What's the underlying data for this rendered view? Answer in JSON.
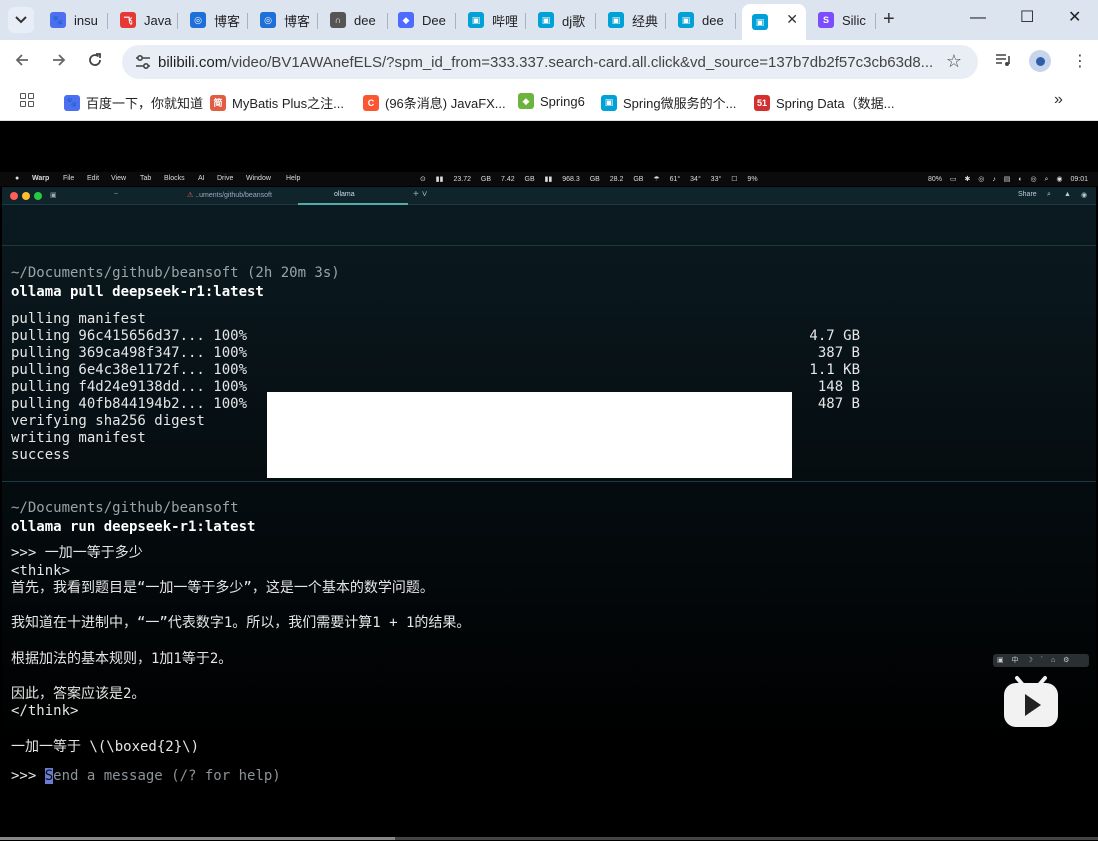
{
  "browser": {
    "tabs": [
      {
        "label": "insu",
        "favicon_color": "#4e6ef2",
        "favicon_glyph": "🐾"
      },
      {
        "label": "Java",
        "favicon_color": "#e53935",
        "favicon_glyph": "飞"
      },
      {
        "label": "博客",
        "favicon_color": "#1e6fd9",
        "favicon_glyph": "◎"
      },
      {
        "label": "博客",
        "favicon_color": "#1e6fd9",
        "favicon_glyph": "◎"
      },
      {
        "label": "dee",
        "favicon_color": "#555555",
        "favicon_glyph": "∩"
      },
      {
        "label": "Dee",
        "favicon_color": "#4d6bfe",
        "favicon_glyph": "◆"
      },
      {
        "label": "哔哩",
        "favicon_color": "#00a1d6",
        "favicon_glyph": "▣"
      },
      {
        "label": "dj歌",
        "favicon_color": "#00a1d6",
        "favicon_glyph": "▣"
      },
      {
        "label": "经典",
        "favicon_color": "#00a1d6",
        "favicon_glyph": "▣"
      },
      {
        "label": "dee",
        "favicon_color": "#00a1d6",
        "favicon_glyph": "▣"
      },
      {
        "label": "",
        "favicon_color": "#00a1d6",
        "favicon_glyph": "▣",
        "active": true
      },
      {
        "label": "Silic",
        "favicon_color": "#7c4dff",
        "favicon_glyph": "S"
      }
    ],
    "new_tab_glyph": "+",
    "window_controls": {
      "minimize": "—",
      "maximize": "☐",
      "close": "✕"
    },
    "address": {
      "host": "bilibili.com",
      "path": "/video/BV1AWAnefELS/?spm_id_from=333.337.search-card.all.click&vd_source=137b7db2f57c3cb63d8..."
    },
    "bookmarks": [
      {
        "label": "百度一下，你就知道",
        "favicon_color": "#4e6ef2",
        "favicon_glyph": "🐾"
      },
      {
        "label": "MyBatis Plus之注...",
        "favicon_color": "#e05d44",
        "favicon_glyph": "简"
      },
      {
        "label": "(96条消息) JavaFX...",
        "favicon_color": "#fc5531",
        "favicon_glyph": "C"
      },
      {
        "label": "Spring6",
        "favicon_color": "#6db33f",
        "favicon_glyph": "◆"
      },
      {
        "label": "Spring微服务的个...",
        "favicon_color": "#00a1d6",
        "favicon_glyph": "▣"
      },
      {
        "label": "Spring Data（数据...",
        "favicon_color": "#d32f2f",
        "favicon_glyph": "51"
      }
    ],
    "bookmarks_more": "»"
  },
  "mac_menubar": {
    "apple": "",
    "items": [
      "Warp",
      "File",
      "Edit",
      "View",
      "Tab",
      "Blocks",
      "AI",
      "Drive",
      "Window",
      "Help"
    ],
    "status_mid": "⊙ ▮▮ 23.72 GB 7.42 GB ▮▮ 968.3 GB 28.2 GB ☂ 61° 34° 33° ☐ 9%",
    "status_right": "80% ▭ ✱ ◎ ♪ ▤ ◐ ◎ ⌕ ◉ 09:01"
  },
  "warp": {
    "tabs": [
      "~",
      "..uments/github/beansoft",
      "ollama"
    ],
    "active_tab": "ollama",
    "right_controls": "Share",
    "block1": {
      "cwd": "~/Documents/github/beansoft (2h 20m 3s)",
      "command": "ollama pull deepseek-r1:latest",
      "lines": [
        "pulling manifest",
        "pulling 96c415656d37... 100%",
        "pulling 369ca498f347... 100%",
        "pulling 6e4c38e1172f... 100%",
        "pulling f4d24e9138dd... 100%",
        "pulling 40fb844194b2... 100%",
        "verifying sha256 digest",
        "writing manifest",
        "success"
      ],
      "sizes": [
        "4.7 GB",
        "387 B",
        "1.1 KB",
        "148 B",
        "487 B"
      ]
    },
    "block2": {
      "cwd": "~/Documents/github/beansoft",
      "command": "ollama run deepseek-r1:latest",
      "lines": [
        ">>> 一加一等于多少",
        "<think>",
        "首先，我看到题目是“一加一等于多少”，这是一个基本的数学问题。",
        "",
        "我知道在十进制中，“一”代表数字1。所以，我们需要计算1 + 1的结果。",
        "",
        "根据加法的基本规则，1加1等于2。",
        "",
        "因此，答案应该是2。",
        "</think>",
        "",
        "一加一等于 \\(\\boxed{2}\\)"
      ]
    },
    "input": {
      "prompt": ">>> ",
      "cursor_char": "S",
      "placeholder_rest": "end a message (/? for help)"
    }
  },
  "video_overlay": {
    "mini_toolbar": "▣ 中 ☽ ˋ ⌂ ⚙",
    "play_icon": "play-icon",
    "progress": 0.36
  }
}
